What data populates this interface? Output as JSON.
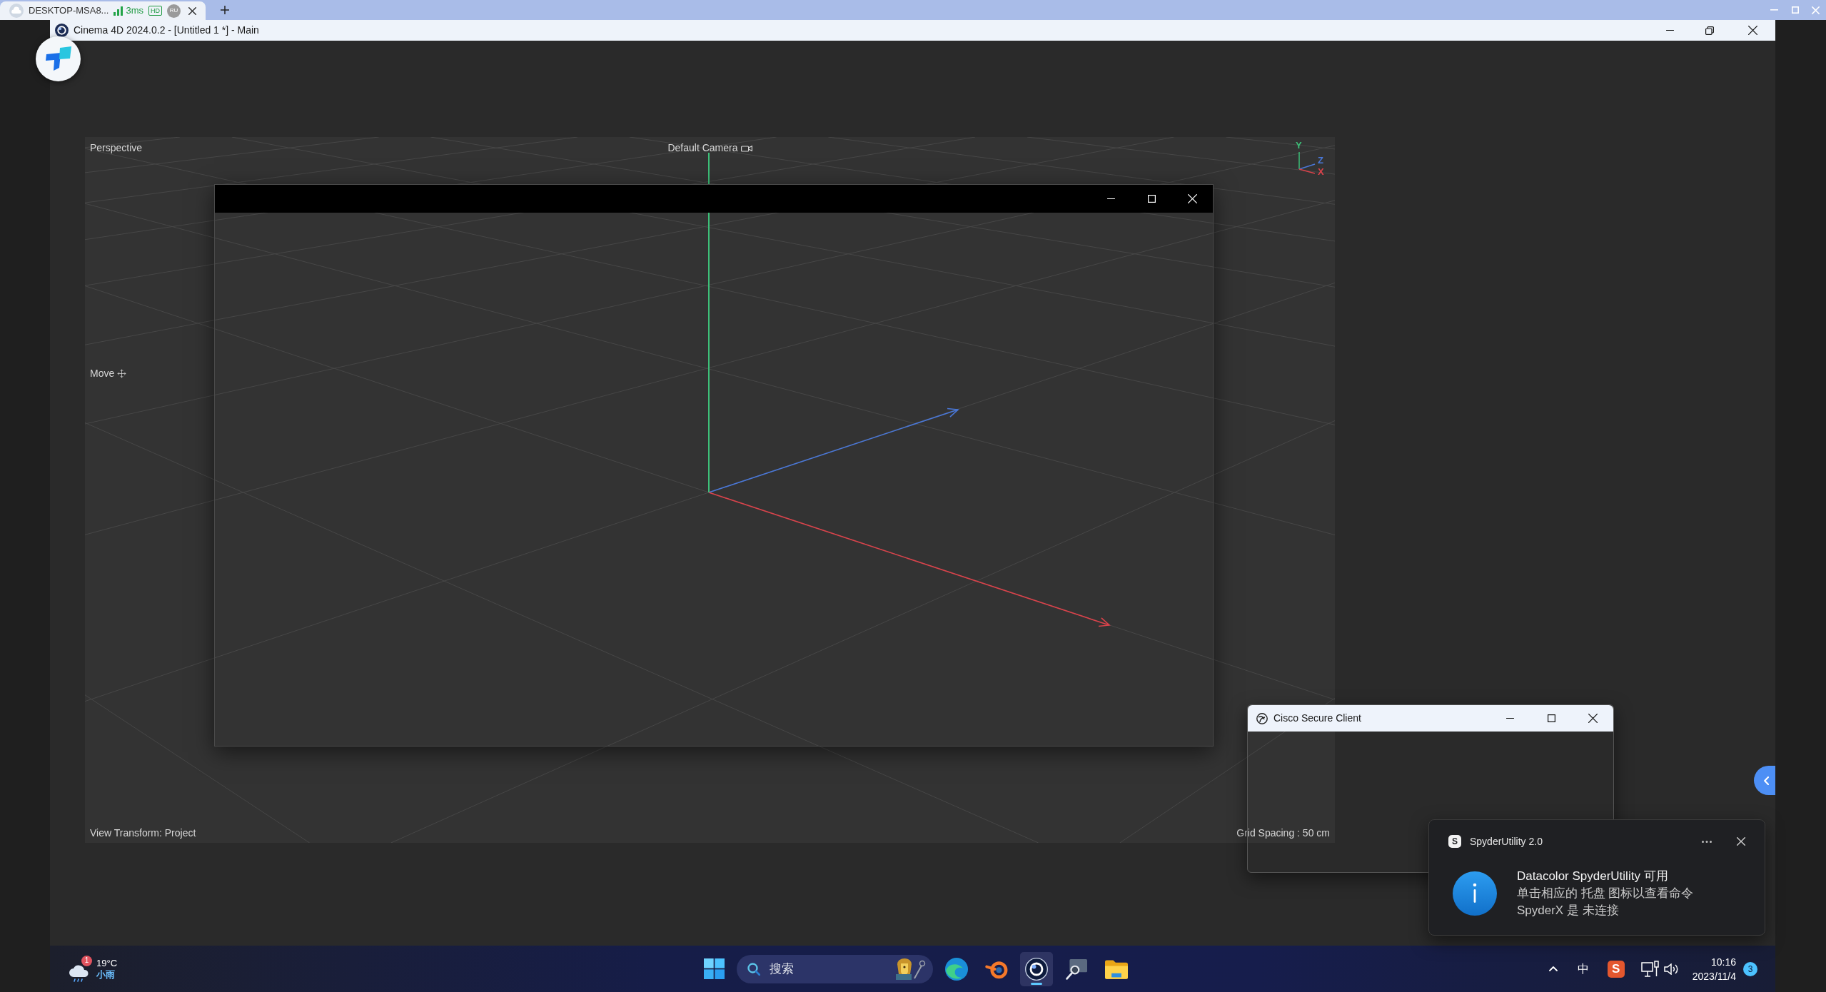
{
  "remote_tab": {
    "title": "DESKTOP-MSA8...",
    "latency": "3ms",
    "quality": "HD",
    "user": "RU"
  },
  "app_window": {
    "title": "Cinema 4D 2024.0.2 - [Untitled 1 *] - Main"
  },
  "viewport": {
    "view": "Perspective",
    "camera": "Default Camera",
    "tool": "Move",
    "axes": [
      {
        "label": "Y",
        "color": "#3dbf78"
      },
      {
        "label": "Z",
        "color": "#4a78d8"
      },
      {
        "label": "X",
        "color": "#d9434b"
      }
    ],
    "view_transform": "View Transform: Project",
    "grid_spacing": "Grid Spacing : 50 cm"
  },
  "cisco_window": {
    "title": "Cisco Secure Client"
  },
  "notification": {
    "app_badge": "S",
    "app": "SpyderUtility 2.0",
    "title": "Datacolor SpyderUtility 可用",
    "lines": [
      "单击相应的 托盘 图标以查看命令",
      "SpyderX 是 未连接"
    ]
  },
  "taskbar": {
    "weather": {
      "alert_count": "1",
      "temperature": "19°C",
      "condition": "小雨"
    },
    "search": {
      "placeholder": "搜索"
    },
    "apps": [
      {
        "kind": "swirl",
        "selected": false
      },
      {
        "kind": "orbit",
        "selected": false
      },
      {
        "kind": "ring",
        "selected": true
      },
      {
        "kind": "magnifier",
        "selected": false
      },
      {
        "kind": "folder",
        "selected": false
      }
    ],
    "tray": {
      "input_mode": "中",
      "ime_badge": "S",
      "time": "10:16",
      "date": "2023/11/4",
      "notification_count": "3"
    }
  }
}
